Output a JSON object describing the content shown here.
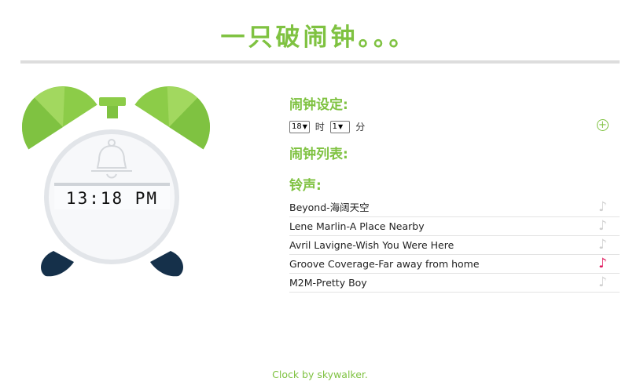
{
  "header": {
    "title": "一只破闹钟。。。"
  },
  "clock": {
    "time": "13:18 PM"
  },
  "settings": {
    "heading": "闹钟设定:",
    "hour_value": "18",
    "hour_unit": "时",
    "minute_value": "1",
    "minute_unit": "分",
    "add_icon": "plus-circle-icon"
  },
  "alarm_list": {
    "heading": "闹钟列表:"
  },
  "ringtones": {
    "heading": "铃声:",
    "items": [
      {
        "label": "Beyond-海阔天空",
        "active": false
      },
      {
        "label": "Lene Marlin-A Place Nearby",
        "active": false
      },
      {
        "label": "Avril Lavigne-Wish You Were Here",
        "active": false
      },
      {
        "label": "Groove Coverage-Far away from home",
        "active": true
      },
      {
        "label": "M2M-Pretty Boy",
        "active": false
      }
    ],
    "icon": "music-note-icon"
  },
  "footer": {
    "text": "Clock by skywalker."
  },
  "colors": {
    "accent": "#7fc241",
    "active_note": "#e0185c",
    "inactive_note": "#d0d0d0",
    "bell_feet": "#15304a"
  }
}
